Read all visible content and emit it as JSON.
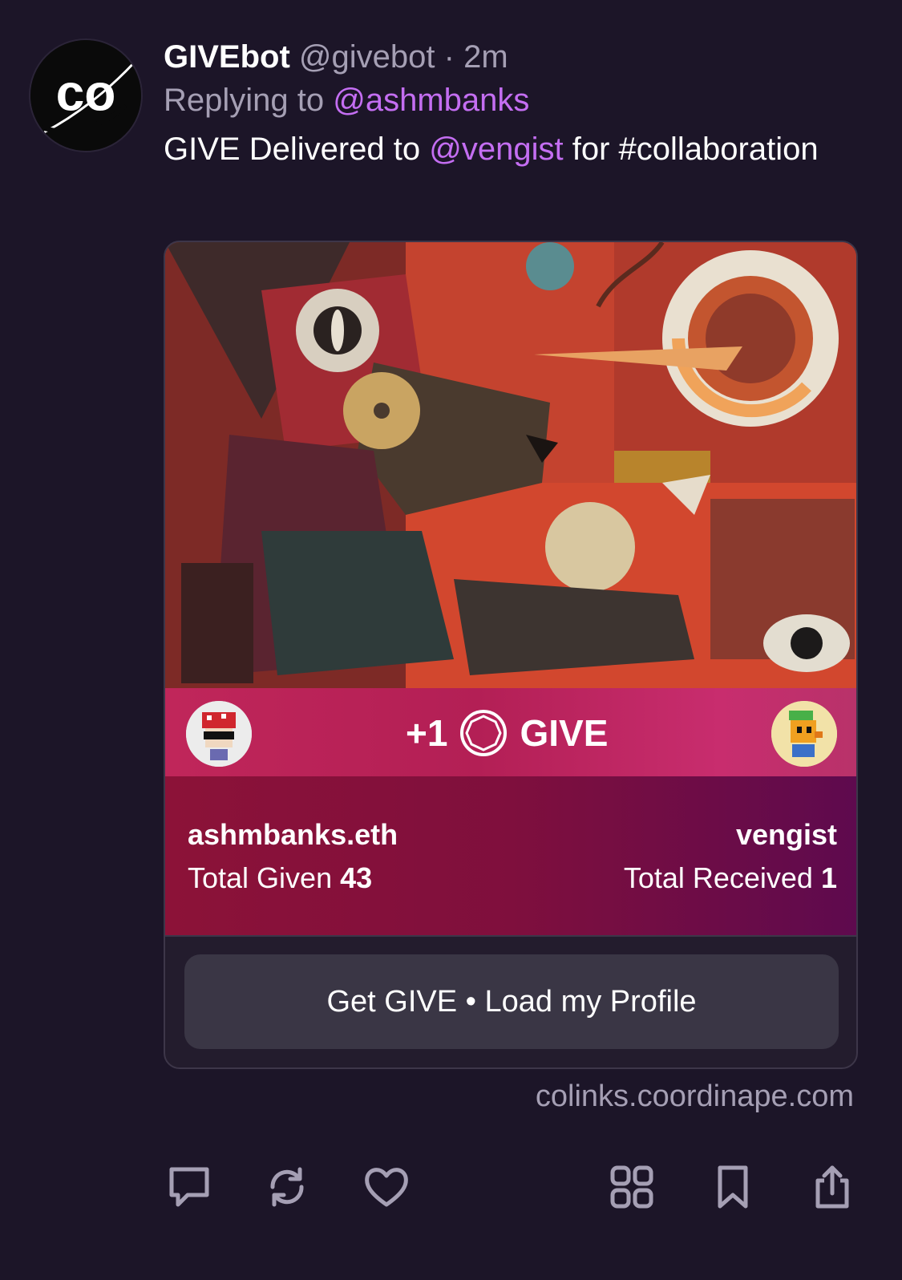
{
  "post": {
    "author": "GIVEbot",
    "handle": "@givebot",
    "separator": "·",
    "time": "2m",
    "reply_prefix": "Replying to",
    "reply_to": "@ashmbanks",
    "text_before": "GIVE Delivered to",
    "text_mention": "@vengist",
    "text_after": "for #collaboration",
    "avatar_logo_text": "co"
  },
  "card": {
    "give_amount": "+1",
    "give_label": "GIVE",
    "giver": {
      "name": "ashmbanks.eth",
      "stat_label": "Total Given",
      "stat_value": "43"
    },
    "receiver": {
      "name": "vengist",
      "stat_label": "Total Received",
      "stat_value": "1"
    },
    "cta_label": "Get GIVE • Load my Profile",
    "domain": "colinks.coordinape.com"
  },
  "actions": {
    "icons": [
      "comment-icon",
      "repost-icon",
      "like-icon",
      "apps-grid-icon",
      "bookmark-icon",
      "share-icon"
    ]
  },
  "colors": {
    "background": "#1c1528",
    "mention": "#c46ef2",
    "muted": "#a59fb4",
    "band": "#c0265a",
    "stats": "#7f0f3d",
    "button": "#3a3645"
  }
}
